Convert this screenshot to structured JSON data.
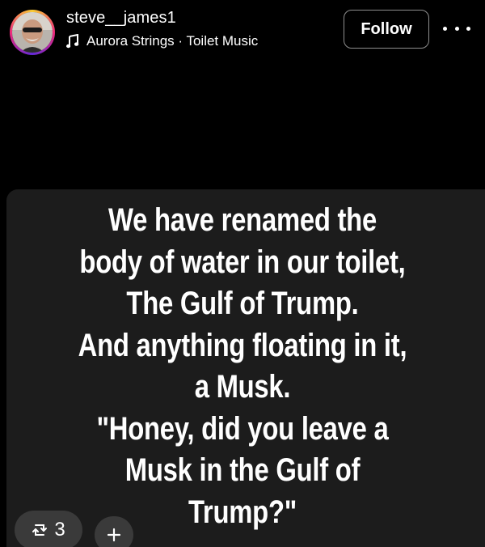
{
  "header": {
    "username": "steve__james1",
    "music": {
      "track": "Aurora Strings · Toilet Music",
      "icon": "music-note-icon"
    },
    "follow_label": "Follow",
    "more_icon": "ellipsis-icon"
  },
  "post": {
    "lines": [
      "We have renamed the",
      "body of water in our toilet,",
      "The Gulf of Trump.",
      "And anything floating in it,",
      "a Musk.",
      "\"Honey, did you leave a",
      "Musk in the Gulf of",
      "Trump?\""
    ]
  },
  "actions": {
    "repost_count": "3",
    "repost_icon": "repost-icon",
    "add_label": "+"
  },
  "colors": {
    "background": "#000000",
    "card": "#1c1c1c",
    "pill": "#3a3a3a",
    "text": "#ffffff",
    "follow_border": "#8e8e8e"
  }
}
